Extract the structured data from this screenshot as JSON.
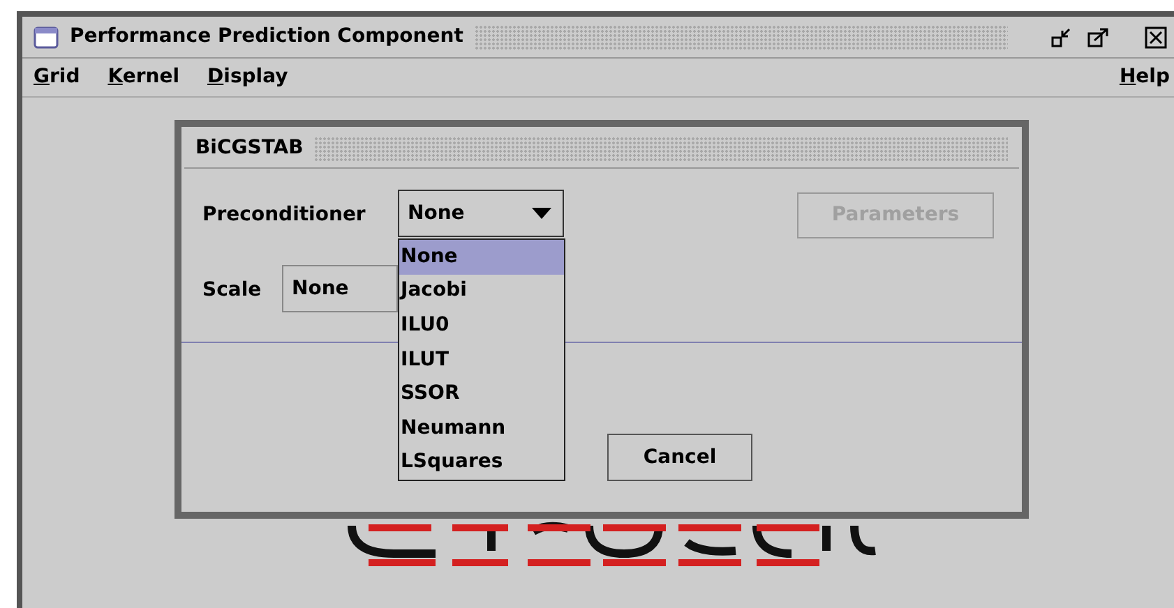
{
  "window": {
    "title": "Performance Prediction Component"
  },
  "menu": {
    "left": [
      "Grid",
      "Kernel",
      "Display"
    ],
    "right": [
      "Help"
    ]
  },
  "dialog": {
    "title": "BiCGSTAB",
    "preconditioner": {
      "label": "Preconditioner",
      "value": "None",
      "expanded": true,
      "options": [
        {
          "label": "None",
          "selected": true
        },
        {
          "label": "Jacobi",
          "selected": false
        },
        {
          "label": "ILU0",
          "selected": false
        },
        {
          "label": "ILUT",
          "selected": false
        },
        {
          "label": "SSOR",
          "selected": false
        },
        {
          "label": "Neumann",
          "selected": false
        },
        {
          "label": "LSquares",
          "selected": false
        }
      ]
    },
    "parameters_button": {
      "label": "Parameters",
      "disabled": true
    },
    "scale": {
      "label": "Scale",
      "value": "None"
    },
    "cancel_button": {
      "label": "Cancel"
    }
  }
}
